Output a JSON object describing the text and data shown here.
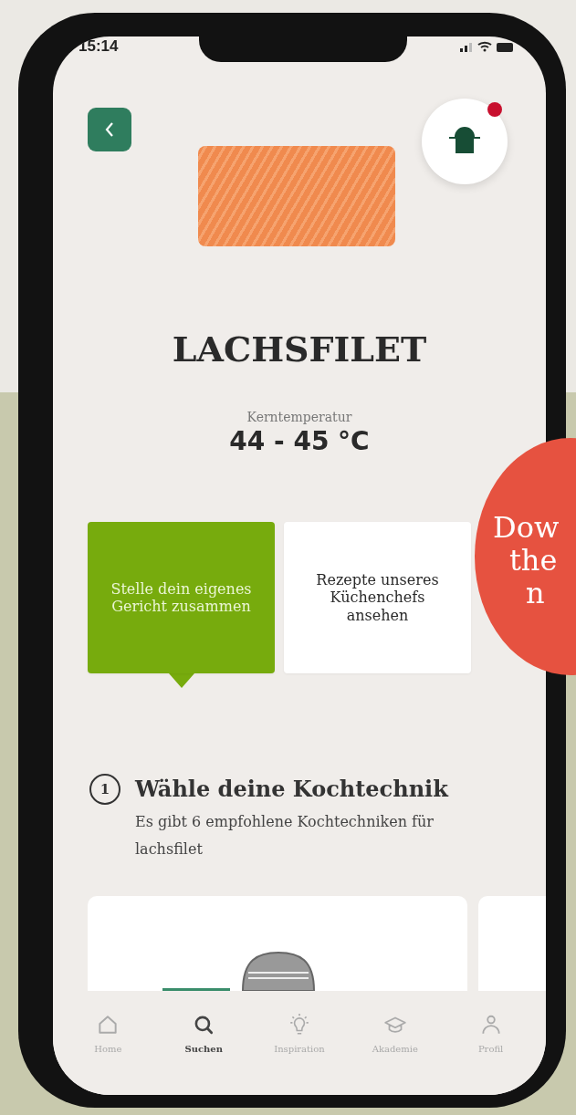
{
  "status_bar": {
    "time": "15:14"
  },
  "product": {
    "title": "LACHSFILET",
    "temperature_label": "Kerntemperatur",
    "temperature": "44 - 45 °C"
  },
  "grill_button": {
    "notification": true
  },
  "tabs": [
    {
      "label": "Stelle dein eigenes Gericht zusammen",
      "selected": true
    },
    {
      "label": "Rezepte unseres Küchenchefs ansehen",
      "selected": false
    }
  ],
  "step": {
    "number": "1",
    "title": "Wähle deine Kochtechnik",
    "subtitle": "Es gibt 6 empfohlene Kochtechniken für lachsfilet"
  },
  "bottom_nav": [
    {
      "label": "Home",
      "selected": false
    },
    {
      "label": "Suchen",
      "selected": true
    },
    {
      "label": "Inspiration",
      "selected": false
    },
    {
      "label": "Akademie",
      "selected": false
    },
    {
      "label": "Profil",
      "selected": false
    }
  ],
  "sticker": {
    "lines": [
      "Dow",
      "the",
      "n"
    ]
  }
}
